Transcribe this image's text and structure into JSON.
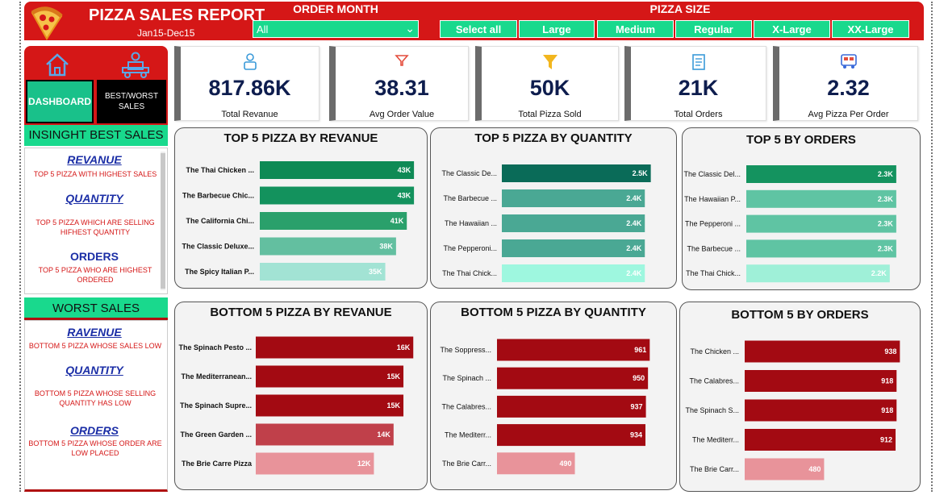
{
  "header": {
    "title": "PIZZA SALES REPORT",
    "date_range": "Jan15-Dec15",
    "order_month_label": "ORDER MONTH",
    "order_month_value": "All",
    "pizza_size_label": "PIZZA SIZE",
    "sizes": [
      "Select all",
      "Large",
      "Medium",
      "Regular",
      "X-Large",
      "XX-Large"
    ],
    "colors": {
      "brand": "#d51717",
      "accent": "#19d98d"
    }
  },
  "sidebar": {
    "nav": {
      "home_icon": "home-icon",
      "delivery_icon": "delivery-icon",
      "dashboard": "DASHBOARD",
      "best_worst": "BEST/WORST SALES"
    },
    "best_title": "INSINGHT BEST SALES",
    "best_items": [
      {
        "title": "REVANUE ",
        "desc": "TOP 5 PIZZA WITH HIGHEST SALES"
      },
      {
        "title": "QUANTITY",
        "desc": "TOP 5 PIZZA WHICH ARE SELLING HIFHEST QUANTITY"
      },
      {
        "title": "ORDERS",
        "desc": "TOP 5 PIZZA WHO ARE HIGHEST ORDERED"
      }
    ],
    "worst_title": "WORST SALES",
    "worst_items": [
      {
        "title": "RAVENUE",
        "desc": "BOTTOM 5 PIZZA WHOSE SALES LOW"
      },
      {
        "title": "QUANTITY",
        "desc": "BOTTOM 5 PIZZA WHOSE SELLING QUANTITY HAS LOW"
      },
      {
        "title": "ORDERS",
        "desc": "BOTTOM 5 PIZZA WHOSE ORDER ARE LOW PLACED"
      }
    ]
  },
  "kpis": [
    {
      "value": "817.86K",
      "label": "Total Revanue",
      "icon": "delivery-person-icon"
    },
    {
      "value": "38.31",
      "label": "Avg Order Value",
      "icon": "filter-icon"
    },
    {
      "value": "50K",
      "label": "Total Pizza Sold",
      "icon": "funnel-icon"
    },
    {
      "value": "21K",
      "label": "Total Orders",
      "icon": "receipt-icon"
    },
    {
      "value": "2.32",
      "label": "Avg Pizza Per Order",
      "icon": "food-truck-icon"
    }
  ],
  "chart_data": [
    {
      "type": "bar",
      "title": "TOP 5 PIZZA BY REVANUE",
      "categories": [
        "The Thai Chicken ...",
        "The Barbecue Chic...",
        "The California Chi...",
        "The Classic Deluxe...",
        "The Spicy Italian P..."
      ],
      "values": [
        43,
        43,
        41,
        38,
        35
      ],
      "labels": [
        "43K",
        "43K",
        "41K",
        "38K",
        "35K"
      ],
      "colors": [
        "#0e8a55",
        "#13925d",
        "#2aa06b",
        "#63bfa0",
        "#a2e3d4"
      ],
      "xlim": [
        0,
        45
      ]
    },
    {
      "type": "bar",
      "title": "TOP 5 PIZZA BY QUANTITY",
      "categories": [
        "The Classic De...",
        "The Barbecue ...",
        "The Hawaiian ...",
        "The Pepperoni...",
        "The Thai Chick..."
      ],
      "values": [
        2.5,
        2.4,
        2.4,
        2.4,
        2.4
      ],
      "labels": [
        "2.5K",
        "2.4K",
        "2.4K",
        "2.4K",
        "2.4K"
      ],
      "colors": [
        "#0a6b58",
        "#4aa894",
        "#4aa894",
        "#4aa894",
        "#9ef7df"
      ],
      "xlim": [
        0,
        2.6
      ]
    },
    {
      "type": "bar",
      "title": "TOP 5 BY ORDERS",
      "categories": [
        "The Classic Del...",
        "The Hawaiian P...",
        "The Pepperoni ...",
        "The Barbecue ...",
        "The Thai Chick..."
      ],
      "values": [
        2.3,
        2.3,
        2.3,
        2.3,
        2.2
      ],
      "labels": [
        "2.3K",
        "2.3K",
        "2.3K",
        "2.3K",
        "2.2K"
      ],
      "colors": [
        "#14935f",
        "#5fc4a3",
        "#5fc4a3",
        "#5fc4a3",
        "#9ff0d8"
      ],
      "xlim": [
        0,
        2.45
      ]
    },
    {
      "type": "bar",
      "title": "BOTTOM 5 PIZZA BY REVANUE",
      "categories": [
        "The Spinach Pesto ...",
        "The Mediterranean...",
        "The Spinach Supre...",
        "The Green Garden ...",
        "The Brie Carre Pizza"
      ],
      "values": [
        16,
        15,
        15,
        14,
        12
      ],
      "labels": [
        "16K",
        "15K",
        "15K",
        "14K",
        "12K"
      ],
      "colors": [
        "#a30a12",
        "#a30a12",
        "#a30a12",
        "#c0404a",
        "#e8939a"
      ],
      "xlim": [
        0,
        16.8
      ]
    },
    {
      "type": "bar",
      "title": "BOTTOM 5 PIZZA BY QUANTITY",
      "categories": [
        "The Soppress...",
        "The Spinach ...",
        "The Calabres...",
        "The Mediterr...",
        "The Brie Carr..."
      ],
      "values": [
        961,
        950,
        937,
        934,
        490
      ],
      "labels": [
        "961",
        "950",
        "937",
        "934",
        "490"
      ],
      "colors": [
        "#a30a12",
        "#a30a12",
        "#a30a12",
        "#a30a12",
        "#e8939a"
      ],
      "xlim": [
        0,
        1000
      ]
    },
    {
      "type": "bar",
      "title": "BOTTOM 5 BY ORDERS",
      "categories": [
        "The Chicken ...",
        "The Calabres...",
        "The Spinach S...",
        "The Mediterr...",
        "The Brie Carr..."
      ],
      "values": [
        938,
        918,
        918,
        912,
        480
      ],
      "labels": [
        "938",
        "918",
        "918",
        "912",
        "480"
      ],
      "colors": [
        "#a30a12",
        "#a30a12",
        "#a30a12",
        "#a30a12",
        "#e8939a"
      ],
      "xlim": [
        0,
        985
      ]
    }
  ]
}
